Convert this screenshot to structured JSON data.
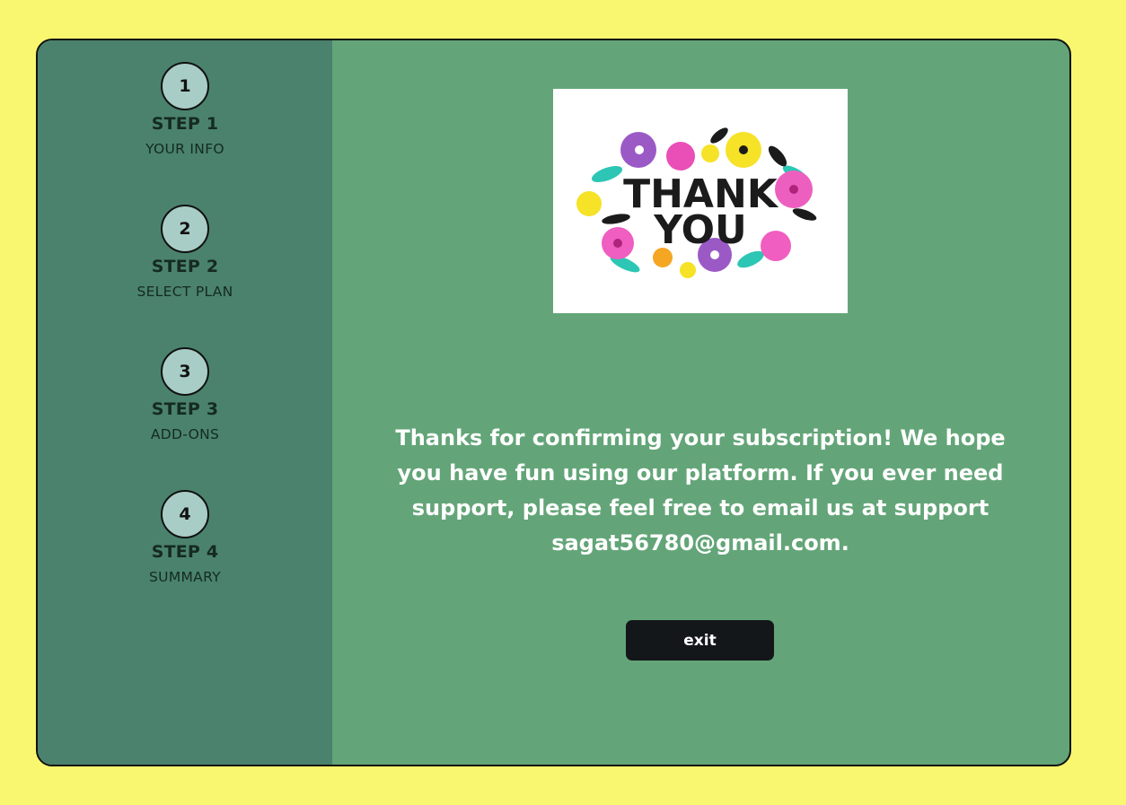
{
  "steps": [
    {
      "number": "1",
      "title": "STEP 1",
      "subtitle": "YOUR INFO"
    },
    {
      "number": "2",
      "title": "STEP 2",
      "subtitle": "SELECT PLAN"
    },
    {
      "number": "3",
      "title": "STEP 3",
      "subtitle": "ADD-ONS"
    },
    {
      "number": "4",
      "title": "STEP 4",
      "subtitle": "SUMMARY"
    }
  ],
  "image": {
    "line1": "THANK",
    "line2": "YOU"
  },
  "message": "Thanks for confirming your subscription! We hope you have fun using our platform. If you ever need support, please feel free to email us at support sagat56780@gmail.com.",
  "exit_label": "exit",
  "colors": {
    "page_bg": "#f8f76f",
    "sidebar_bg": "#4a826e",
    "main_bg": "#63a578",
    "step_circle": "#a8cdc6",
    "button_bg": "#14171a"
  }
}
